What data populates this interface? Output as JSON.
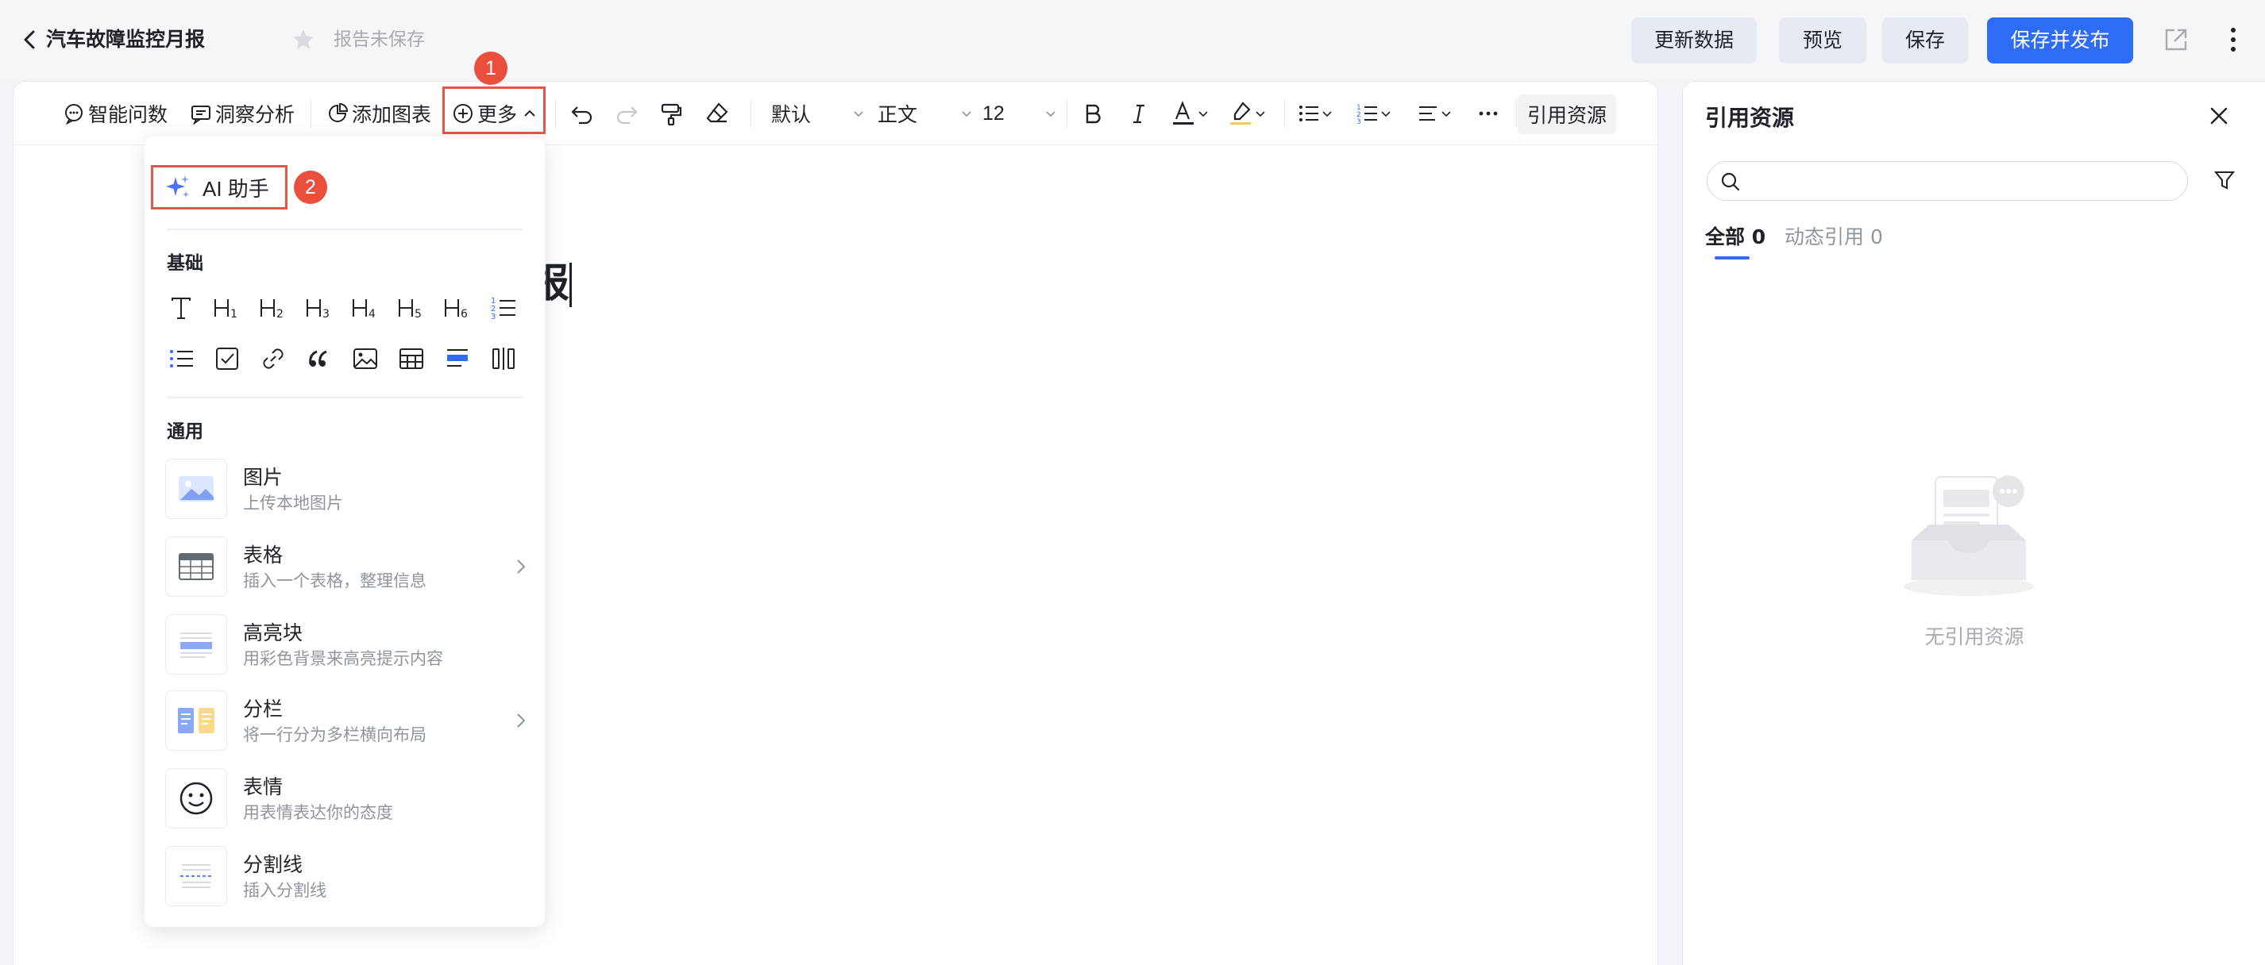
{
  "header": {
    "title": "汽车故障监控月报",
    "save_status": "报告未保存",
    "buttons": {
      "refresh": "更新数据",
      "preview": "预览",
      "save": "保存",
      "save_publish": "保存并发布"
    }
  },
  "toolbar": {
    "smart_qa": "智能问数",
    "insight": "洞察分析",
    "add_chart": "添加图表",
    "more": "更多",
    "font_family": "默认",
    "text_style": "正文",
    "font_size": "12",
    "cite": "引用资源"
  },
  "editor": {
    "heading_visible": "报"
  },
  "annotations": {
    "step1": "1",
    "step2": "2"
  },
  "menu": {
    "ai_label": "AI 助手",
    "basic_title": "基础",
    "common_title": "通用",
    "basic_icons": [
      "text-icon",
      "h1-icon",
      "h2-icon",
      "h3-icon",
      "h4-icon",
      "h5-icon",
      "h6-icon",
      "ordered-list-icon",
      "bullet-list-icon",
      "checkbox-icon",
      "link-icon",
      "quote-icon",
      "image-icon",
      "table-icon",
      "highlight-block-icon",
      "columns-icon"
    ],
    "items": [
      {
        "name": "图片",
        "desc": "上传本地图片"
      },
      {
        "name": "表格",
        "desc": "插入一个表格，整理信息"
      },
      {
        "name": "高亮块",
        "desc": "用彩色背景来高亮提示内容"
      },
      {
        "name": "分栏",
        "desc": "将一行分为多栏横向布局"
      },
      {
        "name": "表情",
        "desc": "用表情表达你的态度"
      },
      {
        "name": "分割线",
        "desc": "插入分割线"
      }
    ]
  },
  "citation_panel": {
    "title": "引用资源",
    "search_placeholder": "",
    "tabs": [
      {
        "label": "全部 0"
      },
      {
        "label": "动态引用 0"
      }
    ],
    "empty_text": "无引用资源"
  },
  "colors": {
    "primary": "#2f6cf6",
    "annotation": "#e65548"
  }
}
